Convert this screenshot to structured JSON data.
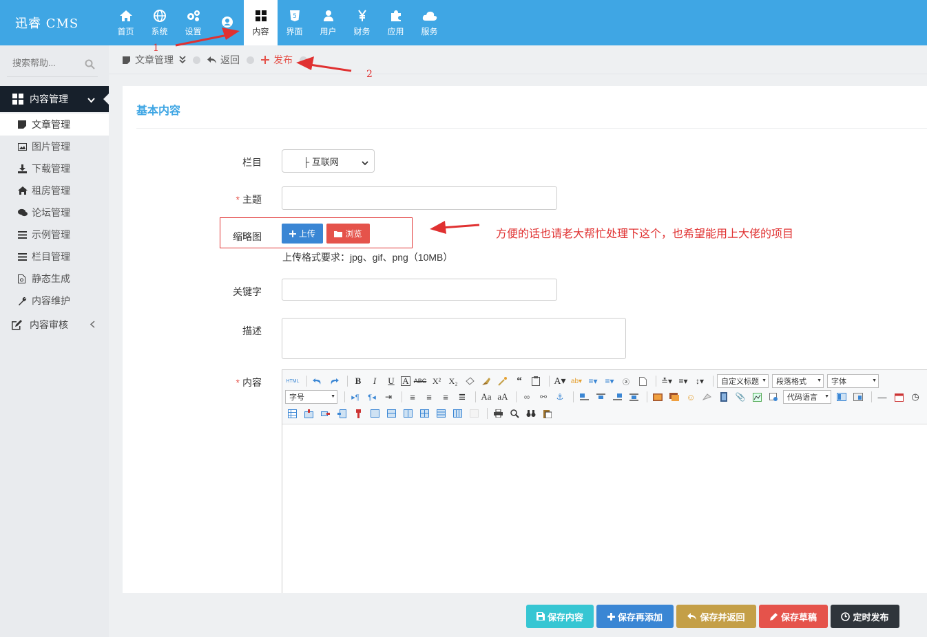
{
  "app": {
    "logo": "迅睿 CMS"
  },
  "nav": [
    {
      "label": "首页",
      "icon": "home-icon"
    },
    {
      "label": "系统",
      "icon": "globe-icon"
    },
    {
      "label": "设置",
      "icon": "gears-icon"
    },
    {
      "label": "",
      "icon": "user-circle-icon"
    },
    {
      "label": "内容",
      "icon": "grid-icon",
      "active": true
    },
    {
      "label": "界面",
      "icon": "html5-icon"
    },
    {
      "label": "用户",
      "icon": "user-icon"
    },
    {
      "label": "财务",
      "icon": "yen-icon"
    },
    {
      "label": "应用",
      "icon": "puzzle-icon"
    },
    {
      "label": "服务",
      "icon": "cloud-icon"
    }
  ],
  "sidebar": {
    "search_placeholder": "搜索帮助...",
    "group": "内容管理",
    "items": [
      {
        "label": "文章管理",
        "icon": "note-icon",
        "active": true
      },
      {
        "label": "图片管理",
        "icon": "image-icon"
      },
      {
        "label": "下载管理",
        "icon": "download-icon"
      },
      {
        "label": "租房管理",
        "icon": "home-icon"
      },
      {
        "label": "论坛管理",
        "icon": "comments-icon"
      },
      {
        "label": "示例管理",
        "icon": "list-icon"
      },
      {
        "label": "栏目管理",
        "icon": "list-icon"
      },
      {
        "label": "静态生成",
        "icon": "file-icon"
      },
      {
        "label": "内容维护",
        "icon": "wrench-icon"
      }
    ],
    "group2": "内容审核"
  },
  "breadcrumb": {
    "module": "文章管理",
    "back": "返回",
    "publish": "发布"
  },
  "form": {
    "panel_title": "基本内容",
    "category_label": "栏目",
    "category_value": "├ 互联网",
    "subject_label": "主题",
    "thumb_label": "缩略图",
    "upload_label": "上传",
    "browse_label": "浏览",
    "upload_hint": "上传格式要求：jpg、gif、png（10MB）",
    "keywords_label": "关键字",
    "desc_label": "描述",
    "content_label": "内容",
    "required_mark": "*"
  },
  "editor": {
    "html_label": "HTML",
    "custom_title": "自定义标题",
    "paragraph": "段落格式",
    "font_family": "字体",
    "font_size": "字号",
    "code_lang": "代码语言"
  },
  "footer": [
    {
      "label": "保存内容",
      "color": "#36c6d3"
    },
    {
      "label": "保存再添加",
      "color": "#3a86d4"
    },
    {
      "label": "保存并返回",
      "color": "#c49f47"
    },
    {
      "label": "保存草稿",
      "color": "#e5534b"
    },
    {
      "label": "定时发布",
      "color": "#2f353b"
    }
  ],
  "annotations": {
    "n1": "1",
    "n2": "2",
    "note": "方便的话也请老大帮忙处理下这个，也希望能用上大佬的项目"
  }
}
